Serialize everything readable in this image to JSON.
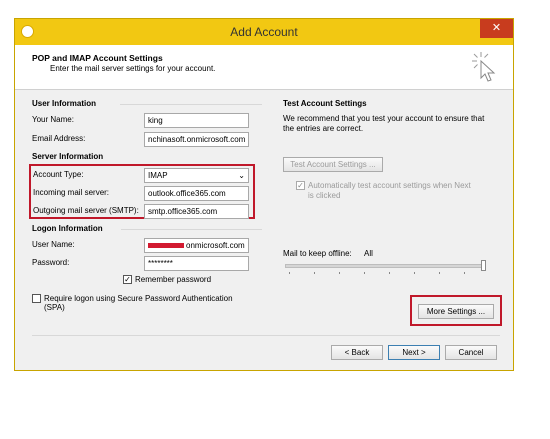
{
  "window": {
    "title": "Add Account",
    "close": "✕"
  },
  "header": {
    "title": "POP and IMAP Account Settings",
    "subtitle": "Enter the mail server settings for your account."
  },
  "user_info": {
    "section": "User Information",
    "name_label": "Your Name:",
    "name_value": "king",
    "email_label": "Email Address:",
    "email_value": "nchinasoft.onmicrosoft.com"
  },
  "server_info": {
    "section": "Server Information",
    "account_type_label": "Account Type:",
    "account_type_value": "IMAP",
    "incoming_label": "Incoming mail server:",
    "incoming_value": "outlook.office365.com",
    "outgoing_label": "Outgoing mail server (SMTP):",
    "outgoing_value": "smtp.office365.com"
  },
  "logon_info": {
    "section": "Logon Information",
    "username_label": "User Name:",
    "username_value": "onmicrosoft.com",
    "password_label": "Password:",
    "password_value": "********",
    "remember_label": "Remember password",
    "remember_checked": true,
    "spa_label_line1": "Require logon using Secure Password Authentication",
    "spa_label_line2": "(SPA)",
    "spa_checked": false
  },
  "test_settings": {
    "section": "Test Account Settings",
    "desc_line1": "We recommend that you test your account to ensure that",
    "desc_line2": "the entries are correct.",
    "test_button": "Test Account Settings ...",
    "auto_test_line1": "Automatically test account settings when Next",
    "auto_test_line2": "is clicked",
    "auto_test_checked": true
  },
  "offline": {
    "label": "Mail to keep offline:",
    "value": "All",
    "slider_level": 1.0
  },
  "buttons": {
    "more_settings": "More Settings ...",
    "back": "< Back",
    "next": "Next >",
    "cancel": "Cancel"
  },
  "colors": {
    "titlebar": "#f2c812",
    "highlight": "#c0182a",
    "redaction": "#d21a30"
  },
  "icons": {
    "app": "outlook-icon",
    "header": "cursor-click-icon"
  }
}
